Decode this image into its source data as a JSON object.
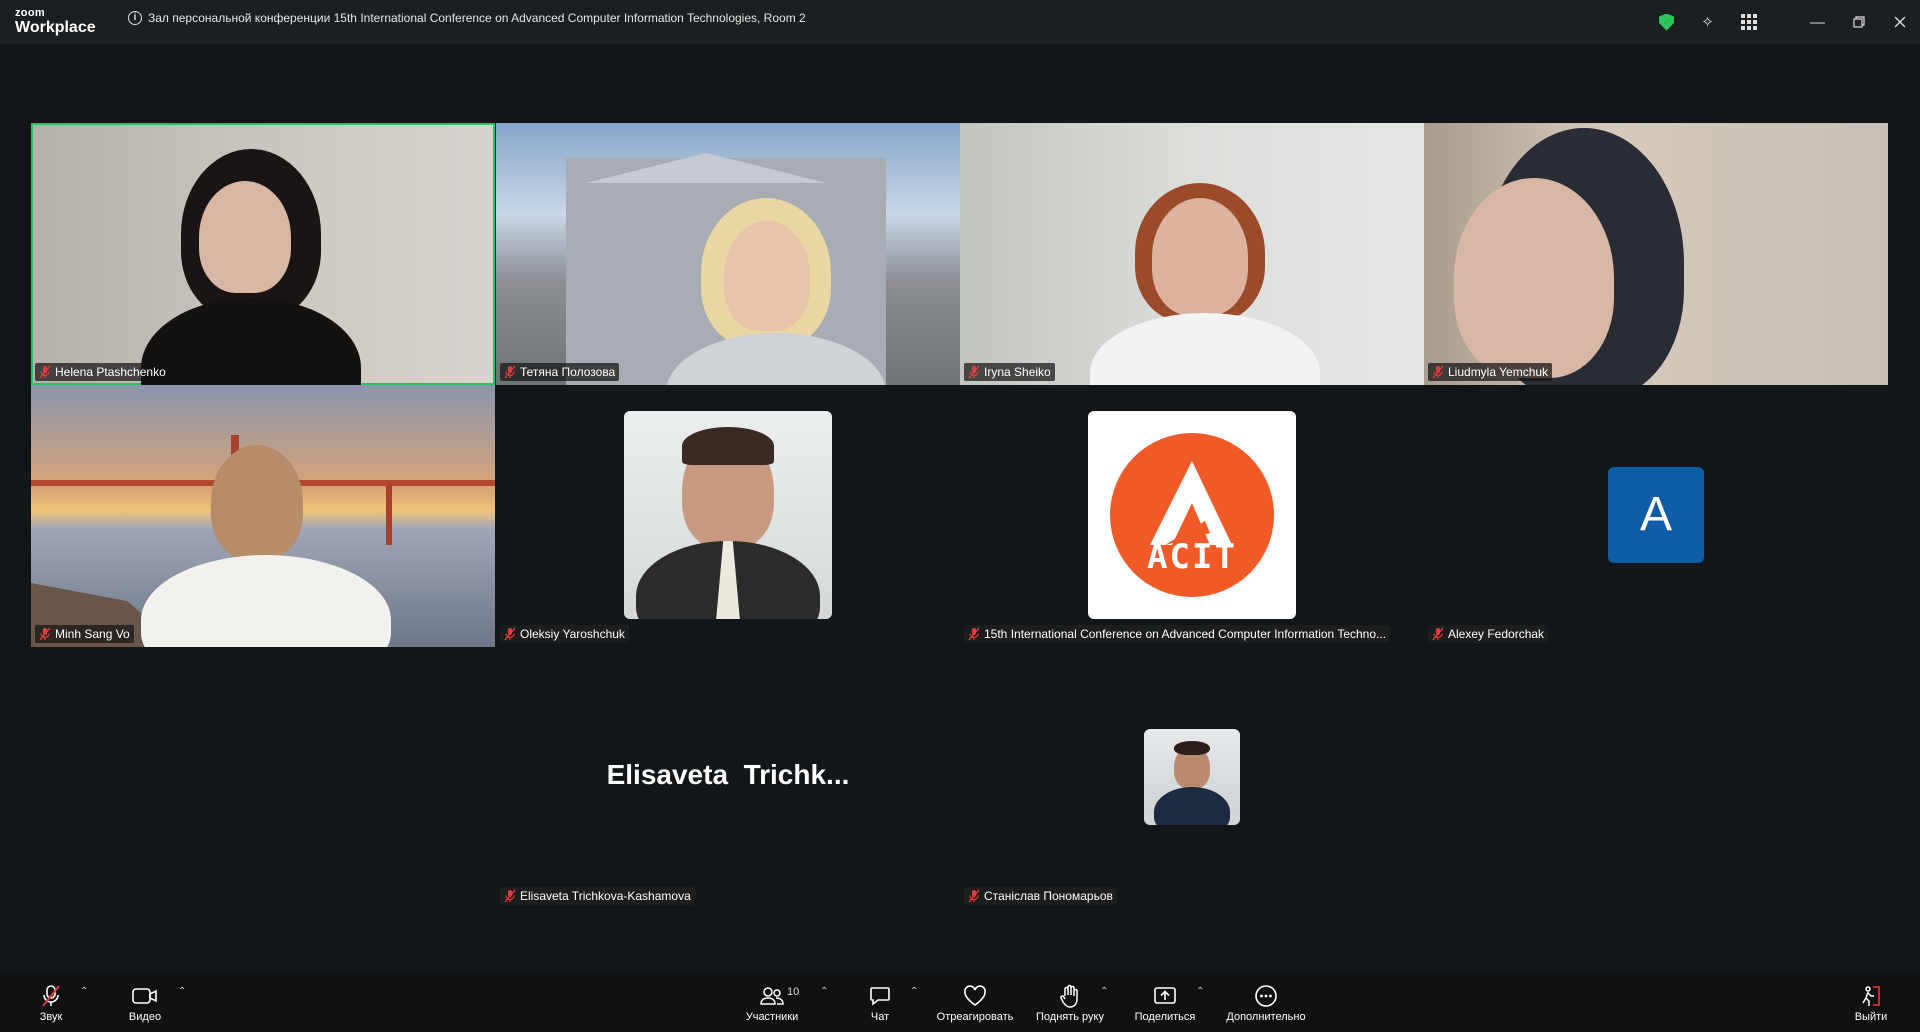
{
  "app": {
    "logo_top": "zoom",
    "logo_bottom": "Workplace"
  },
  "meeting": {
    "title": "Зал персональной конференции 15th International Conference on Advanced Computer Information Technologies, Room 2"
  },
  "colors": {
    "active_speaker": "#22c55e",
    "avatar_blue": "#0e5ba6",
    "acit_orange": "#ef5a26",
    "security_green": "#2ec45c",
    "leave_red": "#e02e2a"
  },
  "participants": [
    {
      "name": "Helena Ptashchenko",
      "muted": true,
      "active": true
    },
    {
      "name": "Тетяна Полозова",
      "muted": true
    },
    {
      "name": "Iryna Sheiko",
      "muted": true
    },
    {
      "name": "Liudmyla Yemchuk",
      "muted": true
    },
    {
      "name": "Minh Sang Vo",
      "muted": true
    },
    {
      "name": "Oleksiy Yaroshchuk",
      "muted": true
    },
    {
      "name": "15th International Conference on Advanced Computer Information Techno...",
      "muted": true,
      "logo_text": "ACIT"
    },
    {
      "name": "Alexey Fedorchak",
      "muted": true,
      "avatar_letter": "A"
    },
    {
      "name": "Elisaveta Trichkova-Kashamova",
      "muted": true,
      "display_text": "Elisaveta  Trichk..."
    },
    {
      "name": "Станіслав Пономарьов",
      "muted": true
    }
  ],
  "toolbar": {
    "audio": "Звук",
    "video": "Видео",
    "participants": "Участники",
    "participants_count": "10",
    "chat": "Чат",
    "react": "Отреагировать",
    "raise_hand": "Поднять руку",
    "share": "Поделиться",
    "more": "Дополнительно",
    "leave": "Выйти"
  }
}
